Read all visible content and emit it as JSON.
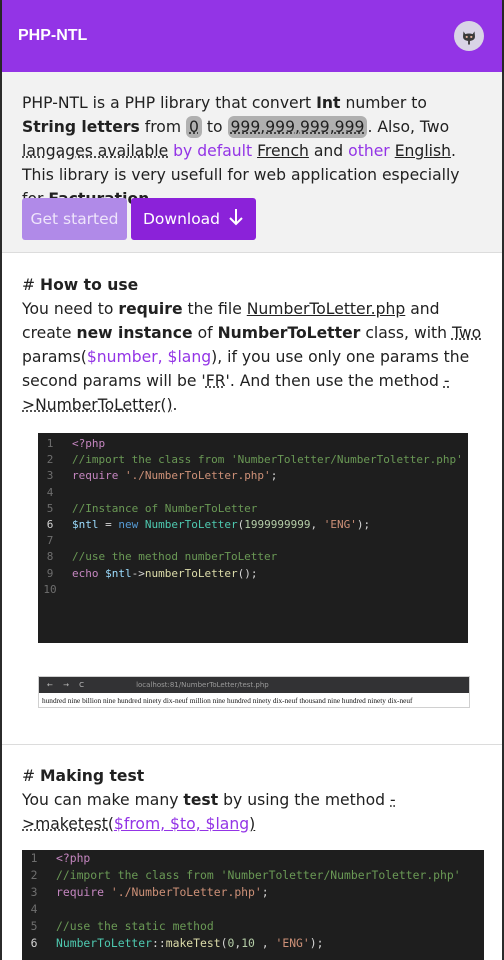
{
  "topbar": {
    "title": "PHP-NTL"
  },
  "intro": {
    "t1": "PHP-NTL is a PHP library that convert ",
    "b_int": "Int",
    "t2": " number to ",
    "b_string": "String letters",
    "t3": " from ",
    "min": "0",
    "t4": " to ",
    "max": "999,999,999,999",
    "t5": ". Also, Two ",
    "langs": "langages available",
    "t6": " by default ",
    "french": "French",
    "t7": " and ",
    "other": "other",
    "t8": " ",
    "english": "English",
    "t9": ". This library is very usefull for web application especially for ",
    "b_fact": "Facturation."
  },
  "buttons": {
    "get_started": "Get started",
    "download": "Download",
    "download_icon": "↓"
  },
  "howto": {
    "hash": "# ",
    "title": "How to use",
    "t1": "You need to ",
    "b_require": "require",
    "t2": " the file ",
    "file": "NumberToLetter.php",
    "t3": " and create ",
    "b_new": "new instance",
    "t4": " of ",
    "b_class": "NumberToLetter",
    "t5": " class, with ",
    "two": "Two",
    "t6": " params(",
    "params": "$number, $lang",
    "t7": "), if you use only one params the second params will be '",
    "fr": "FR",
    "t8": "'. And then use the method ",
    "method": "->NumberToLetter()",
    "t9": "."
  },
  "code1": {
    "ln": [
      "1",
      "2",
      "3",
      "4",
      "5",
      "6",
      "7",
      "8",
      "9",
      "10"
    ],
    "l1": "<?php",
    "l2": "//import the class from 'NumberToletter/NumberToletter.php'",
    "l3a": "require",
    "l3b": " './NumberToLetter.php'",
    "l3c": ";",
    "l5": "//Instance of NumberToLetter",
    "l6a": "$ntl",
    "l6b": " = ",
    "l6c": "new",
    "l6d": " ",
    "l6e": "NumberToLetter",
    "l6f": "(",
    "l6g": "1999999999",
    "l6h": ", ",
    "l6i": "'ENG'",
    "l6j": ");",
    "l8": "//use the method numberToLetter",
    "l9a": "echo",
    "l9b": " ",
    "l9c": "$ntl",
    "l9d": "->",
    "l9e": "numberToLetter",
    "l9f": "();"
  },
  "mini": {
    "nav": "← → C",
    "url": "localhost:81/NumberToLetter/test.php",
    "output": "hundred nine billion nine hundred ninety dix-neuf million nine hundred ninety dix-neuf thousand nine hundred ninety dix-neuf"
  },
  "maketest": {
    "hash": "# ",
    "title": "Making test",
    "t1": "You can make many ",
    "b_test": "test",
    "t2": " by using the method ",
    "method": "->maketest(",
    "params": "$from, $to, $lang",
    "close": ")"
  },
  "code2": {
    "ln": [
      "1",
      "2",
      "3",
      "4",
      "5",
      "6"
    ],
    "l1": "<?php",
    "l2": "//import the class from 'NumberToletter/NumberToletter.php'",
    "l3a": "require",
    "l3b": " './NumberToLetter.php'",
    "l3c": ";",
    "l5": "//use the static method",
    "l6a": "NumberToLetter",
    "l6b": "::",
    "l6c": "makeTest",
    "l6d": "(",
    "l6e": "0",
    "l6f": ",",
    "l6g": "10",
    "l6h": " , ",
    "l6i": "'ENG'",
    "l6j": ");"
  },
  "colors": {
    "accent": "#9334e6",
    "code_bg": "#1e1e1e"
  },
  "icons": {
    "github": "github-octocat-icon",
    "download": "arrow-down-icon"
  }
}
